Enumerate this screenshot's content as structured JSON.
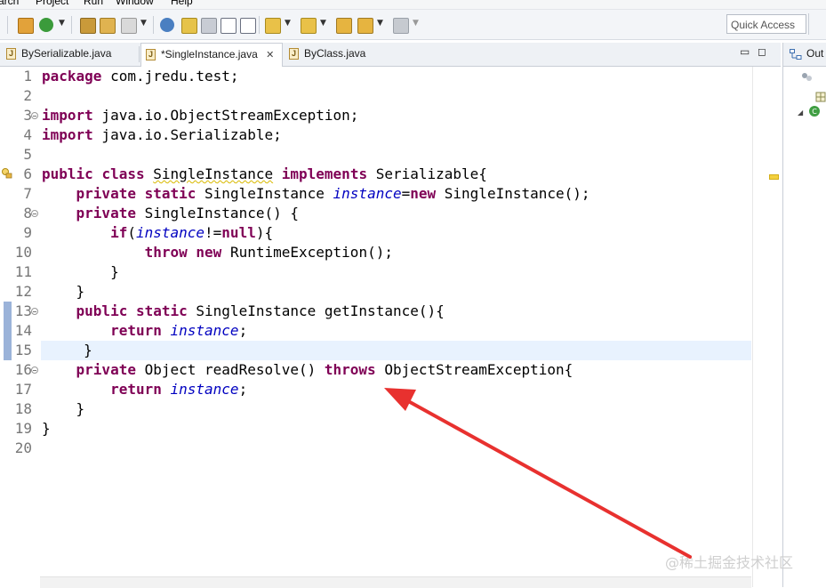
{
  "menu": [
    "arch",
    "Project",
    "Run",
    "Window",
    "Help"
  ],
  "toolbar": {
    "quick_access_placeholder": "Quick Access",
    "icons": [
      "new-icon",
      "run-icon",
      "open-type-icon",
      "open-task-icon",
      "wand-icon",
      "search-icon",
      "pin-icon",
      "coverage-icon",
      "toggle-mark-icon",
      "show-whitespace-icon",
      "next-annotation-icon",
      "prev-annotation-icon",
      "last-edit-icon",
      "back-icon",
      "forward-icon"
    ]
  },
  "tabs": [
    {
      "label": "BySerializable.java",
      "active": false
    },
    {
      "label": "*SingleInstance.java",
      "active": true,
      "close": "✕"
    },
    {
      "label": "ByClass.java",
      "active": false
    }
  ],
  "right_panel": {
    "label": "Out"
  },
  "editor": {
    "line_numbers": [
      "1",
      "2",
      "3",
      "4",
      "5",
      "6",
      "7",
      "8",
      "9",
      "10",
      "11",
      "12",
      "13",
      "14",
      "15",
      "16",
      "17",
      "18",
      "19",
      "20"
    ],
    "current_line": 15
  },
  "watermark": "@稀土掘金技术社区",
  "colors": {
    "keyword": "#7f0055",
    "field": "#0000c0",
    "current_line": "#e8f2fe",
    "arrow": "#e8312f"
  }
}
